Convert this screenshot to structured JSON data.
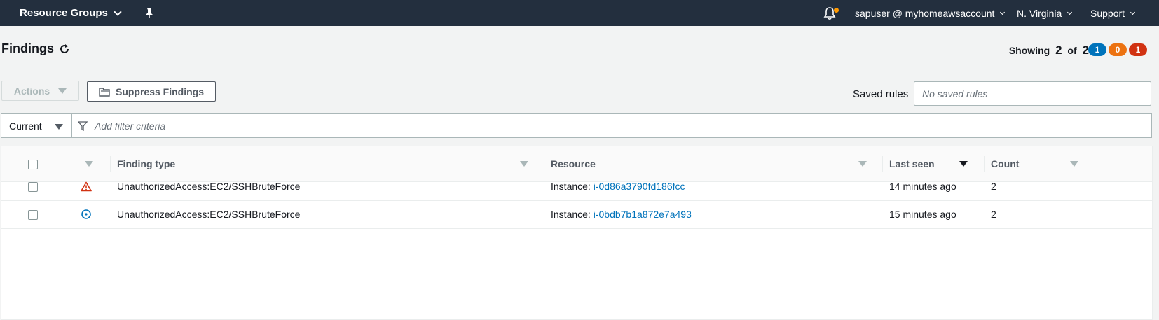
{
  "topbar": {
    "service_menu": "Resource Groups",
    "account": "sapuser @ myhomeawsaccount",
    "region": "N. Virginia",
    "support": "Support"
  },
  "page": {
    "title": "Findings",
    "showing_label": "Showing",
    "showing_count": "2",
    "of_label": "of",
    "total_count": "2",
    "severity_counts": {
      "low": "1",
      "medium": "0",
      "high": "1"
    }
  },
  "toolbar": {
    "actions_label": "Actions",
    "suppress_label": "Suppress Findings",
    "saved_rules_label": "Saved rules",
    "saved_rules_placeholder": "No saved rules"
  },
  "filter": {
    "selected": "Current",
    "placeholder": "Add filter criteria"
  },
  "table": {
    "headers": {
      "finding_type": "Finding type",
      "resource": "Resource",
      "last_seen": "Last seen",
      "count": "Count"
    },
    "rows": [
      {
        "severity": "high",
        "severity_icon": "warning-triangle-icon",
        "finding_type": "UnauthorizedAccess:EC2/SSHBruteForce",
        "resource_prefix": "Instance:",
        "resource_id": "i-0d86a3790fd186fcc",
        "last_seen": "14 minutes ago",
        "count": "2"
      },
      {
        "severity": "low",
        "severity_icon": "info-circle-icon",
        "finding_type": "UnauthorizedAccess:EC2/SSHBruteForce",
        "resource_prefix": "Instance:",
        "resource_id": "i-0bdb7b1a872e7a493",
        "last_seen": "15 minutes ago",
        "count": "2"
      }
    ]
  },
  "colors": {
    "topbar_bg": "#232f3e",
    "severity_low": "#0073bb",
    "severity_medium": "#ec7211",
    "severity_high": "#d13212",
    "link": "#0073bb",
    "notification_dot": "#ff9900"
  }
}
